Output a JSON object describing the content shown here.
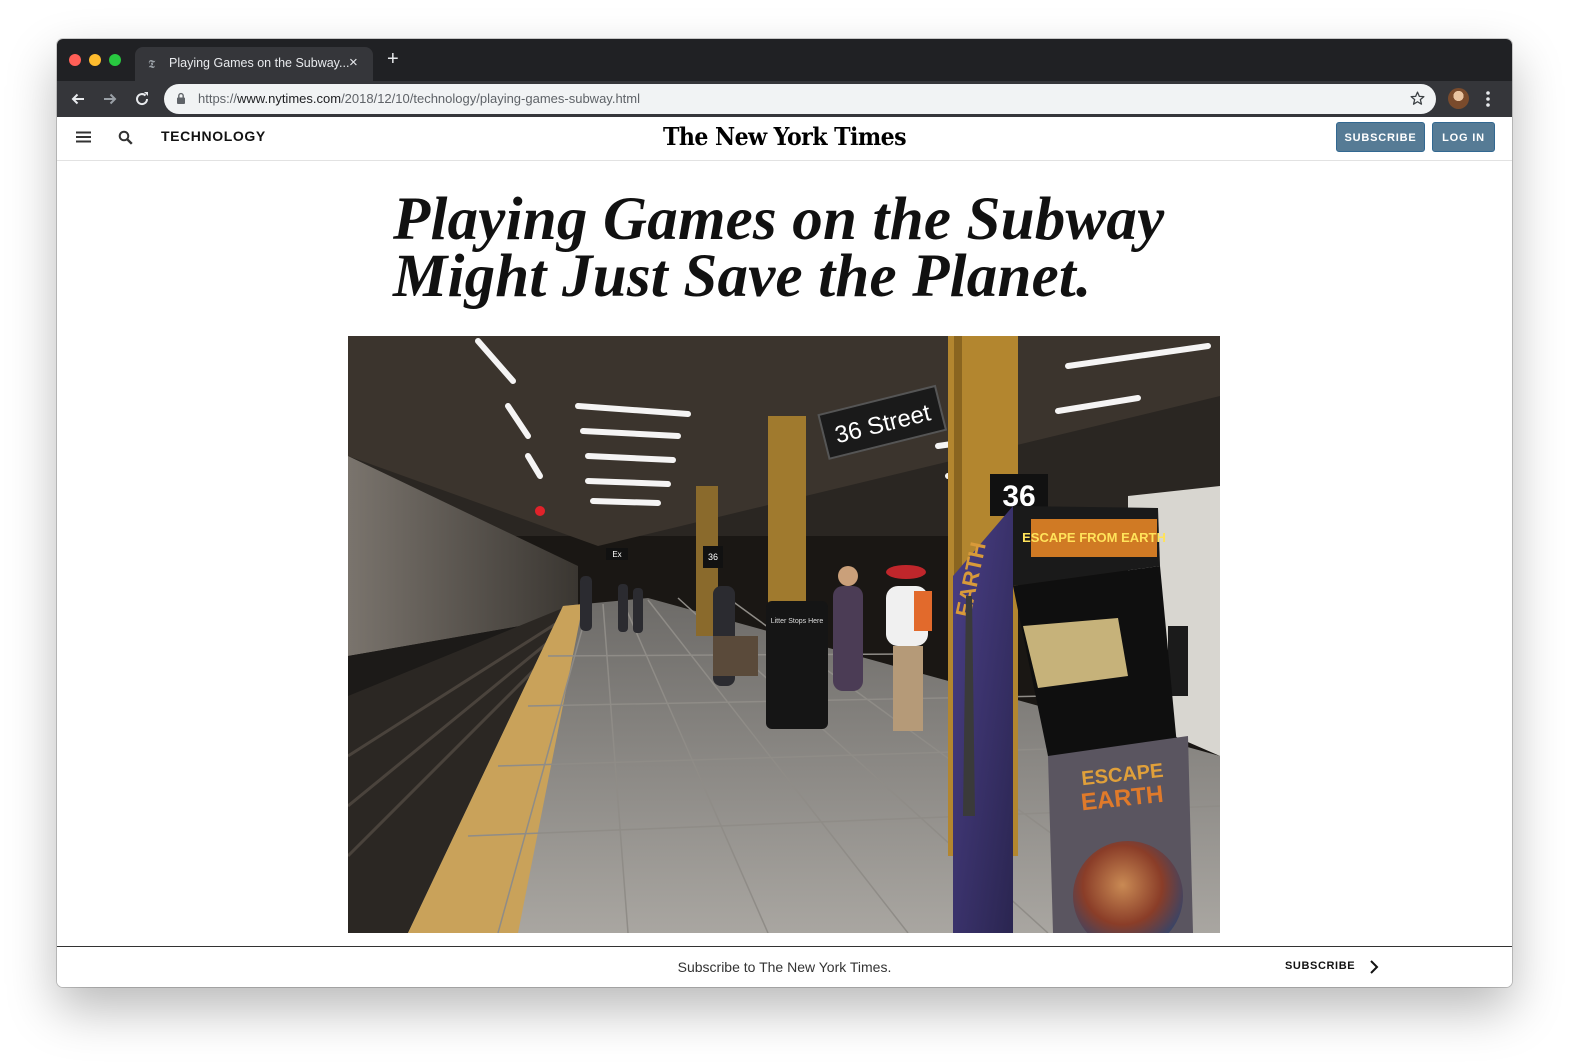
{
  "browser": {
    "tab": {
      "title": "Playing Games on the Subway...",
      "favicon": "nyt-t-icon",
      "close_glyph": "×"
    },
    "new_tab_glyph": "+",
    "address": {
      "scheme": "https://",
      "host": "www.nytimes.com",
      "path": "/2018/12/10/technology/playing-games-subway.html"
    }
  },
  "header": {
    "section": "TECHNOLOGY",
    "masthead": "The New York Times",
    "subscribe_label": "SUBSCRIBE",
    "login_label": "LOG IN"
  },
  "article": {
    "headline_line1": "Playing Games on the Subway",
    "headline_line2": "Might Just Save the Planet.",
    "photo": {
      "station_sign": "36 Street",
      "pillar_number": "36",
      "small_sign": "36",
      "exit_sign": "Ex",
      "bin_label": "Litter Stops Here",
      "arcade_title": "ESCAPE FROM EARTH"
    }
  },
  "subscribe_bar": {
    "text": "Subscribe to The New York Times.",
    "cta": "SUBSCRIBE"
  },
  "colors": {
    "chrome_dark": "#202124",
    "toolbar": "#35363a",
    "button_blue": "#567b95",
    "text": "#121212"
  }
}
